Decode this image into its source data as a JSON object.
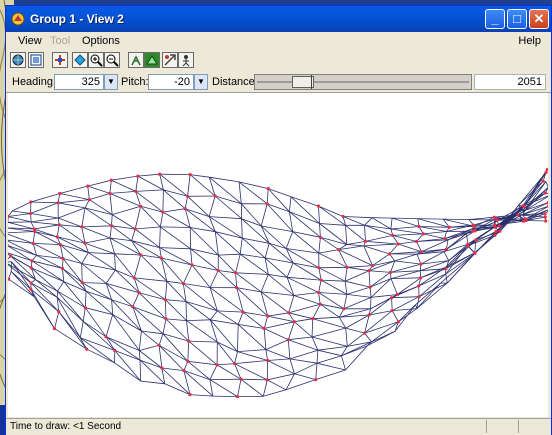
{
  "window": {
    "title": "Group 1 - View 2",
    "controls": {
      "minimize": "_",
      "maximize": "□",
      "close": "✕"
    }
  },
  "menu": {
    "view": "View",
    "tool": "Tool",
    "options": "Options",
    "help": "Help"
  },
  "toolbar": {
    "icons": [
      "globe-icon",
      "frame-icon",
      "pan-icon",
      "navigate-icon",
      "zoom-in-icon",
      "zoom-out-icon",
      "walk-icon",
      "render-icon",
      "fly-icon",
      "figure-icon"
    ]
  },
  "navigation": {
    "heading_label": "Heading:",
    "heading_value": "325",
    "pitch_label": "Pitch:",
    "pitch_value": "-20",
    "distance_label": "Distance:",
    "distance_value": "2051",
    "distance_slider_fraction": 0.18
  },
  "status": {
    "text": "Time to draw: <1 Second"
  },
  "colors": {
    "mesh_line": "#2a2f6b",
    "vertex": "#e0304a",
    "titlebar": "#0a5ae8"
  }
}
